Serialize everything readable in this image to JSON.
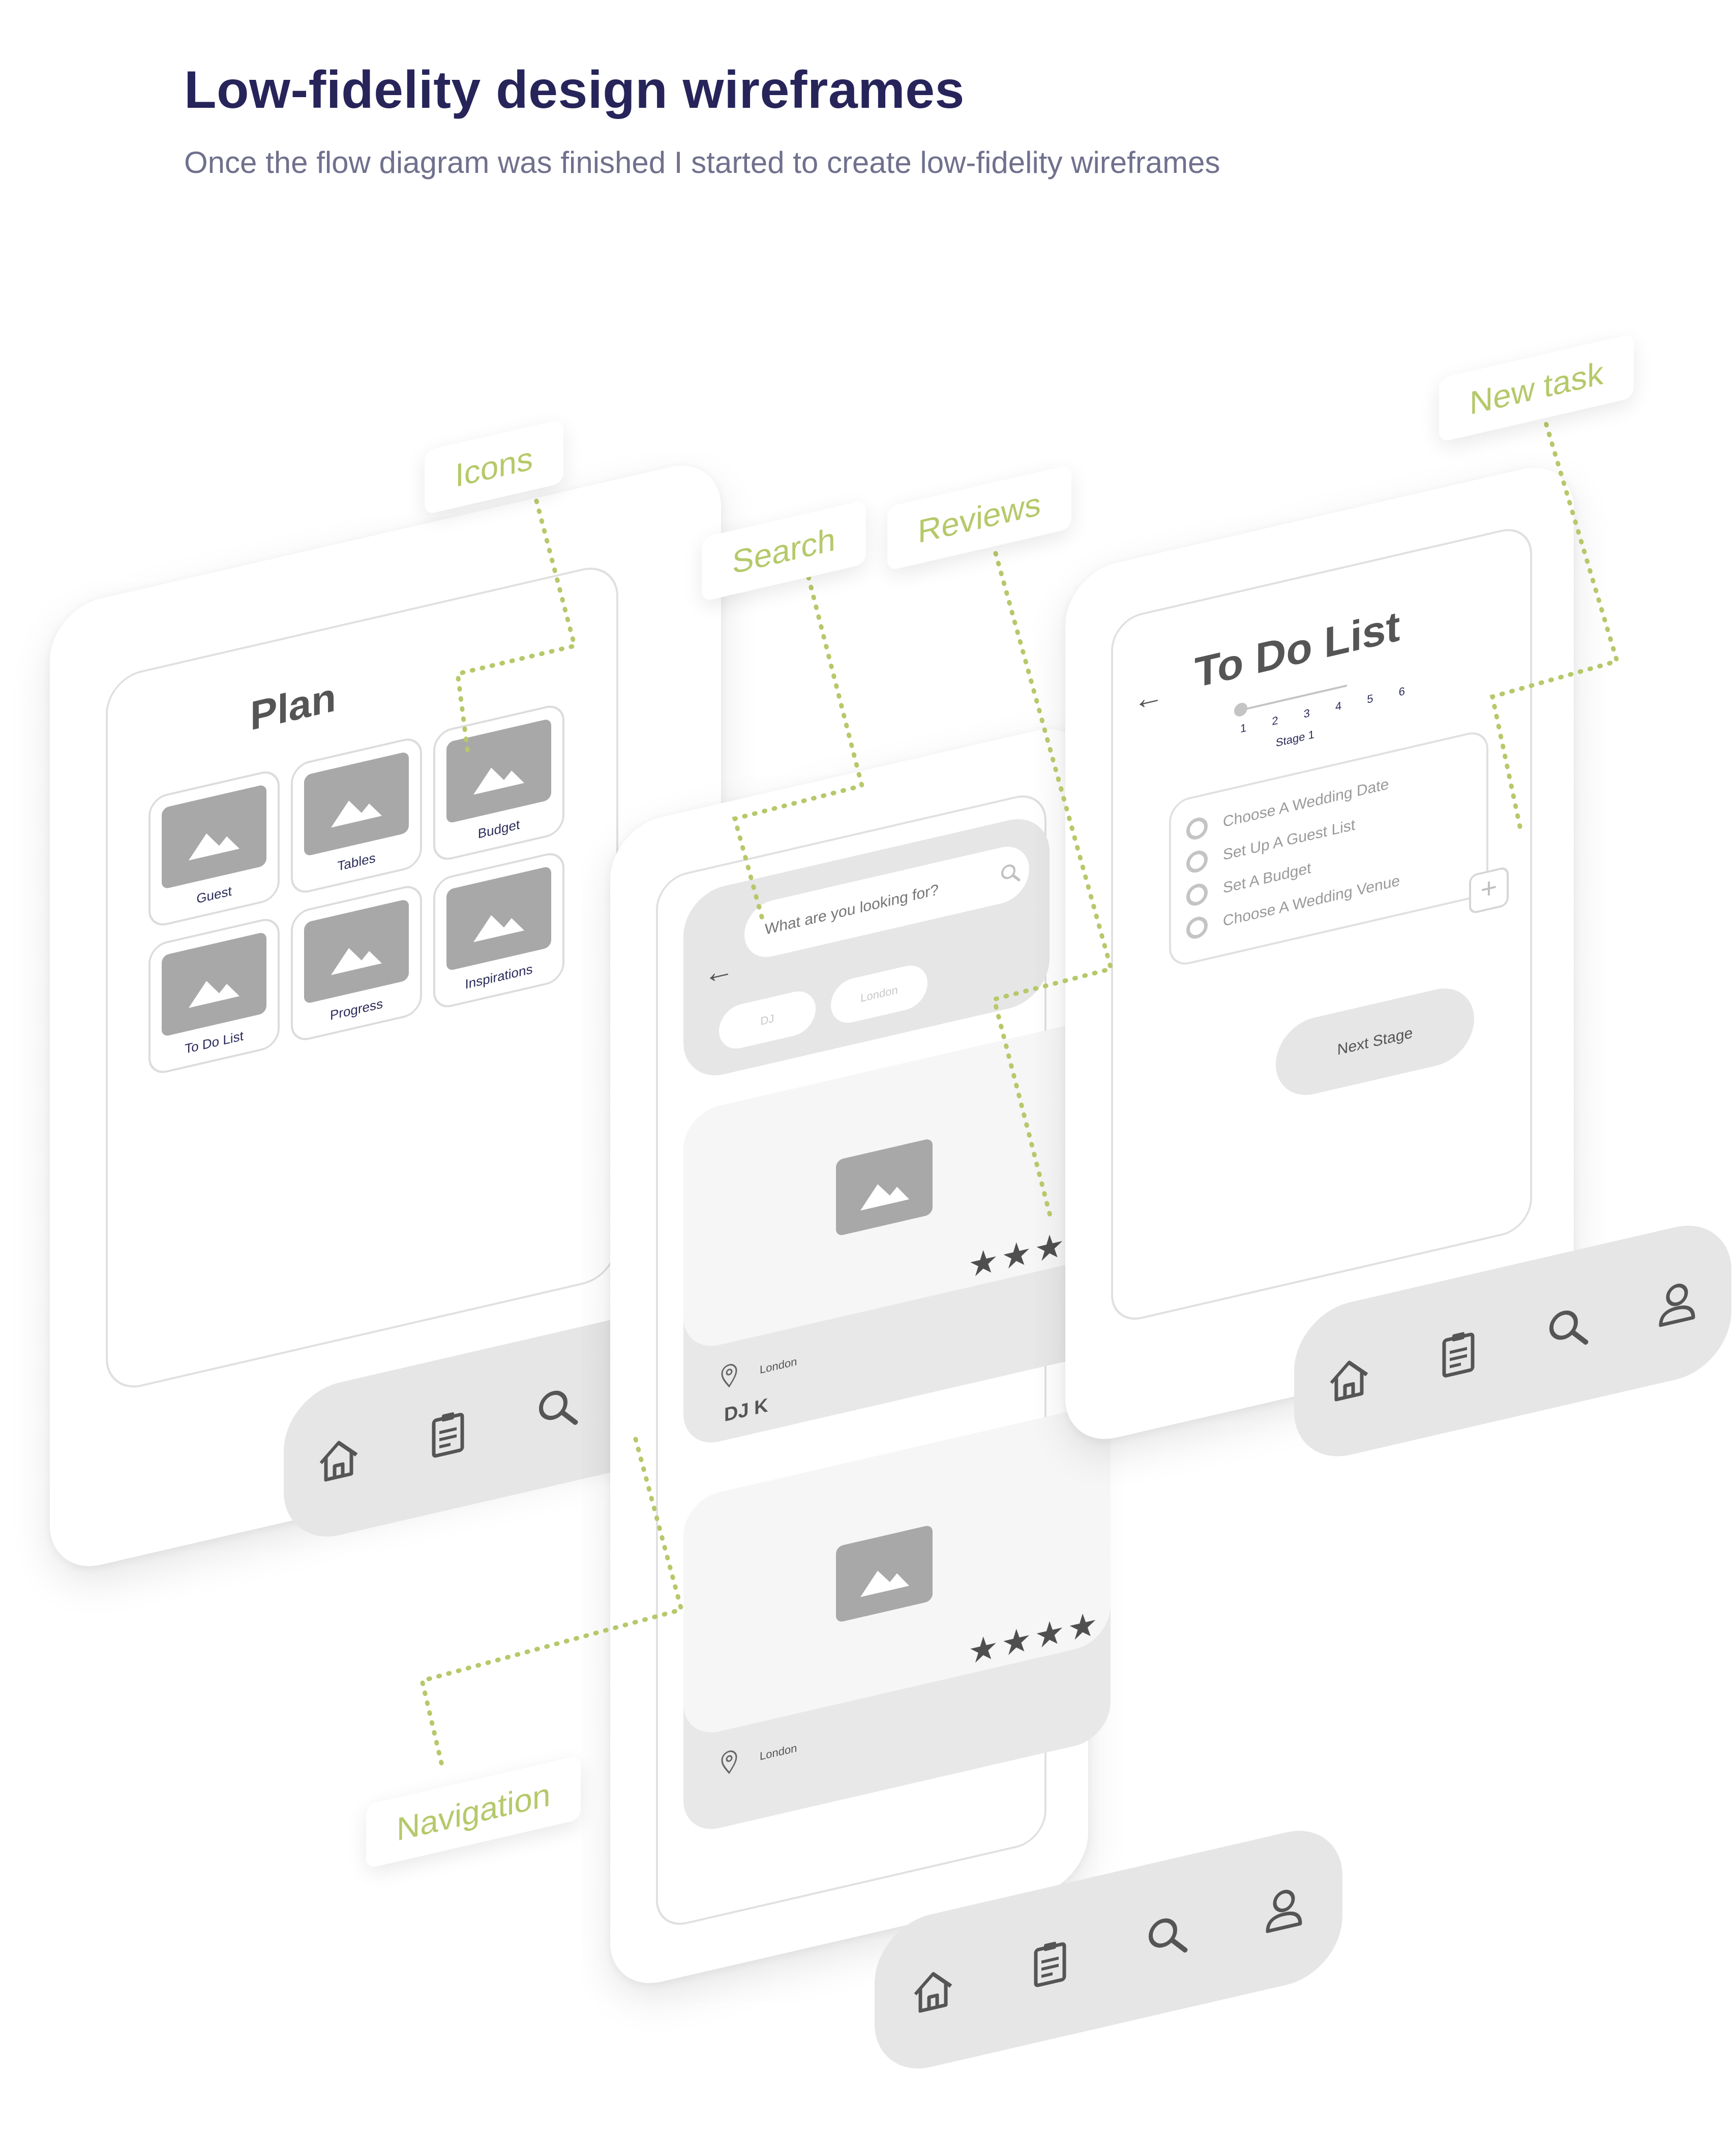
{
  "header": {
    "title": "Low-fidelity design wireframes",
    "subtitle": "Once the flow diagram was finished I started to create low-fidelity wireframes"
  },
  "colors": {
    "title": "#27245a",
    "subtitle": "#70708e",
    "annotation": "#b5c96a",
    "wireframe_gray": "#e6e6e6",
    "placeholder_gray": "#a8a8a8"
  },
  "annotations": {
    "icons": "Icons",
    "search": "Search",
    "reviews": "Reviews",
    "new_task": "New task",
    "navigation": "Navigation"
  },
  "plan_screen": {
    "title": "Plan",
    "tiles": [
      {
        "label": "Guest"
      },
      {
        "label": "Tables"
      },
      {
        "label": "Budget"
      },
      {
        "label": "To Do List"
      },
      {
        "label": "Progress"
      },
      {
        "label": "Inspirations"
      }
    ]
  },
  "search_screen": {
    "back_icon": "arrow-left-icon",
    "search_placeholder": "What are you looking for?",
    "chips": [
      "DJ",
      "London"
    ],
    "results": [
      {
        "stars": "★★★★",
        "location": "London",
        "name": "DJ K"
      },
      {
        "stars": "★★★★",
        "location": "London",
        "name": ""
      }
    ]
  },
  "todo_screen": {
    "title": "To Do List",
    "stages": "1 2 3 4 5 6",
    "stage_label": "Stage 1",
    "tasks": [
      "Choose A Wedding Date",
      "Set Up A Guest List",
      "Set A Budget",
      "Choose A Wedding Venue"
    ],
    "add_label": "+",
    "next_button": "Next Stage"
  },
  "nav_icons": [
    "home-icon",
    "clipboard-icon",
    "search-icon",
    "user-icon"
  ]
}
